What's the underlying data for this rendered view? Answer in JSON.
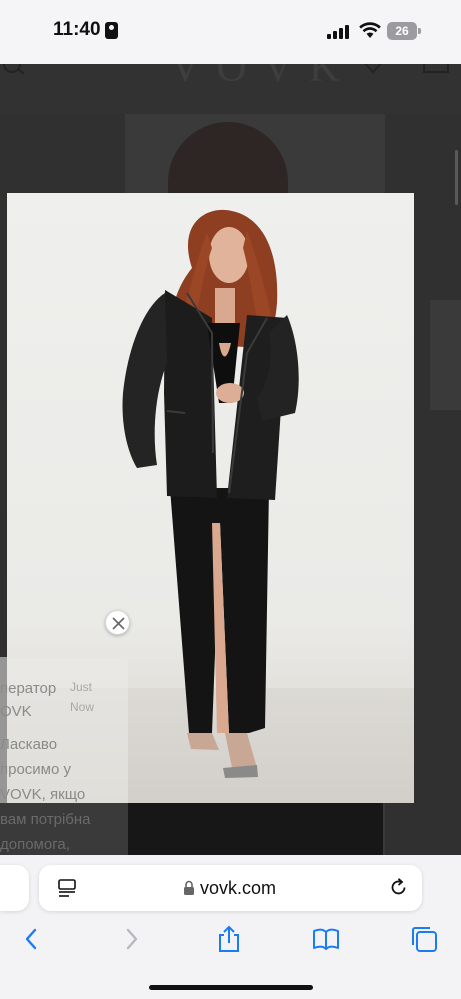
{
  "status_bar": {
    "time": "11:40",
    "battery": "26",
    "icons": [
      "id-card-icon",
      "signal-icon",
      "wifi-icon",
      "battery-icon"
    ]
  },
  "site": {
    "logo": "VOVK",
    "icons": [
      "search-icon",
      "heart-icon",
      "bag-icon"
    ]
  },
  "modal": {
    "close_icon": "close-icon"
  },
  "chat": {
    "sender": [
      "ператор",
      "OVK"
    ],
    "time": [
      "Just",
      "Now"
    ],
    "message": [
      "Ласкаво",
      "просимо у",
      "VOVK, якщо",
      "вам потрібна",
      "допомога,"
    ]
  },
  "safari": {
    "url": "vovk.com",
    "accent": "#1a7cf5",
    "nav_icons": [
      "back-icon",
      "forward-icon",
      "share-icon",
      "bookmarks-icon",
      "tabs-icon"
    ]
  }
}
